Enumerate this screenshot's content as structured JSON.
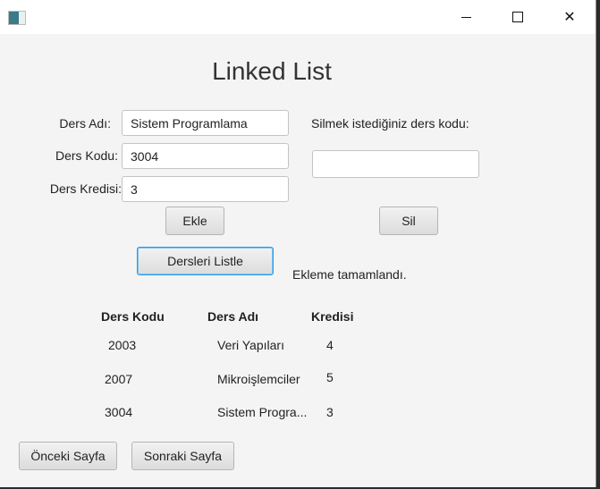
{
  "window": {
    "title": "Linked List",
    "minimize": "—",
    "maximize": "☐",
    "close": "✕"
  },
  "form": {
    "ders_adi_label": "Ders Adı:",
    "ders_adi_value": "Sistem Programlama",
    "ders_kodu_label": "Ders Kodu:",
    "ders_kodu_value": "3004",
    "ders_kredisi_label": "Ders Kredisi:",
    "ders_kredisi_value": "3",
    "ekle": "Ekle",
    "sil_label": "Silmek istediğiniz ders kodu:",
    "sil_value": "",
    "sil": "Sil",
    "listele": "Dersleri Listle",
    "status": "Ekleme tamamlandı."
  },
  "table": {
    "headers": [
      "Ders Kodu",
      "Ders Adı",
      "Kredisi"
    ],
    "rows": [
      [
        "2003",
        "Veri Yapıları",
        "4"
      ],
      [
        "2007",
        "Mikroişlemciler",
        "5"
      ],
      [
        "3004",
        "Sistem Progra...",
        "3"
      ]
    ]
  },
  "pager": {
    "prev": "Önceki Sayfa",
    "next": "Sonraki Sayfa"
  }
}
